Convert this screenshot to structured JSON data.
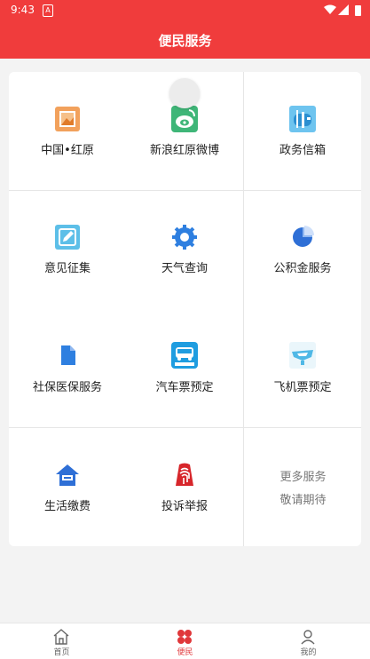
{
  "status_bar": {
    "time": "9:43",
    "notification": "A"
  },
  "header": {
    "title": "便民服务"
  },
  "services": [
    {
      "label": "中国•红原",
      "icon": "picture-frame-icon"
    },
    {
      "label": "新浪红原微博",
      "icon": "weibo-icon"
    },
    {
      "label": "政务信箱",
      "icon": "mailbox-icon"
    },
    {
      "label": "意见征集",
      "icon": "edit-note-icon"
    },
    {
      "label": "天气查询",
      "icon": "gear-icon"
    },
    {
      "label": "公积金服务",
      "icon": "pie-chart-icon"
    },
    {
      "label": "社保医保服务",
      "icon": "document-icon"
    },
    {
      "label": "汽车票预定",
      "icon": "bus-icon"
    },
    {
      "label": "飞机票预定",
      "icon": "airplane-icon"
    },
    {
      "label": "生活缴费",
      "icon": "house-icon"
    },
    {
      "label": "投诉举报",
      "icon": "fingerprint-icon"
    }
  ],
  "more": {
    "line1": "更多服务",
    "line2": "敬请期待"
  },
  "tabs": [
    {
      "label": "首页",
      "icon": "home-icon"
    },
    {
      "label": "便民",
      "icon": "grid-icon"
    },
    {
      "label": "我的",
      "icon": "user-icon"
    }
  ],
  "colors": {
    "brand": "#f03c3c",
    "active_tab": "#e0373a"
  }
}
